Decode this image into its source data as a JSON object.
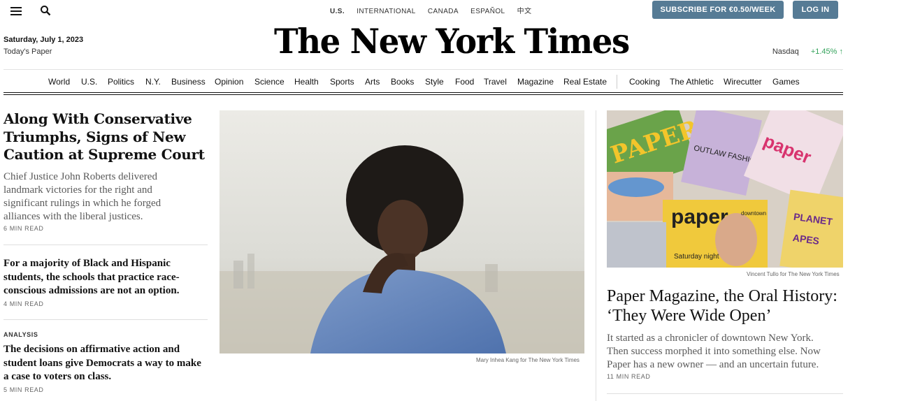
{
  "header": {
    "editions": [
      "U.S.",
      "INTERNATIONAL",
      "CANADA",
      "ESPAÑOL",
      "中文"
    ],
    "subscribe_label": "SUBSCRIBE FOR €0.50/WEEK",
    "login_label": "LOG IN",
    "date": "Saturday, July 1, 2023",
    "todays_paper": "Today's Paper",
    "masthead": "The New York Times",
    "ticker": {
      "name": "Nasdaq",
      "change": "+1.45% ↑"
    },
    "icons": [
      "menu-icon",
      "search-icon"
    ]
  },
  "nav": {
    "sections": [
      "World",
      "U.S.",
      "Politics",
      "N.Y.",
      "Business",
      "Opinion",
      "Science",
      "Health",
      "Sports",
      "Arts",
      "Books",
      "Style",
      "Food",
      "Travel",
      "Magazine",
      "Real Estate"
    ],
    "products": [
      "Cooking",
      "The Athletic",
      "Wirecutter",
      "Games"
    ]
  },
  "lead_story": {
    "headline": "Along With Conservative Triumphs, Signs of New Caution at Supreme Court",
    "summary": "Chief Justice John Roberts delivered landmark victories for the right and significant rulings in which he forged alliances with the liberal justices.",
    "read_time": "6 MIN READ",
    "photo_credit": "Mary Inhea Kang for The New York Times"
  },
  "story2": {
    "headline": "For a majority of Black and Hispanic students, the schools that practice race-conscious admissions are not an option.",
    "read_time": "4 MIN READ"
  },
  "story3": {
    "kicker": "ANALYSIS",
    "headline": "The decisions on affirmative action and student loans give Democrats a way to make a case to voters on class.",
    "read_time": "5 MIN READ"
  },
  "right_story": {
    "headline": "Paper Magazine, the Oral History: ‘They Were Wide Open’",
    "summary": "It started as a chronicler of downtown New York. Then success morphed it into something else. Now Paper has a new owner — and an uncertain future.",
    "read_time": "11 MIN READ",
    "photo_credit": "Vincent Tullo for The New York Times",
    "collage_text": [
      "paper",
      "paper",
      "PAPER",
      "OUTLAW FASHION",
      "Saturday night special",
      "downtown",
      "PLANET",
      "APES"
    ]
  },
  "colors": {
    "accent": "#567b95",
    "ticker_up": "#35a35c",
    "ink": "#121212",
    "summary": "#5a5a5a"
  }
}
